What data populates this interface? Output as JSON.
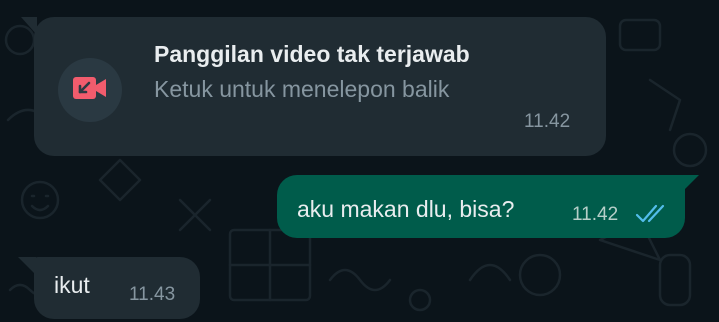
{
  "colors": {
    "background": "#0b141a",
    "incoming_bubble": "#202c33",
    "outgoing_bubble": "#005c4b",
    "missed_call_red": "#f15c6d",
    "read_tick_blue": "#53bdeb"
  },
  "messages": [
    {
      "type": "missed-call",
      "direction": "incoming",
      "title": "Panggilan video tak terjawab",
      "subtitle": "Ketuk untuk menelepon balik",
      "time": "11.42",
      "icon": "missed-video-call-icon"
    },
    {
      "type": "text",
      "direction": "outgoing",
      "text": "aku makan dlu, bisa?",
      "time": "11.42",
      "status": "read",
      "status_icon": "double-check-icon"
    },
    {
      "type": "text",
      "direction": "incoming",
      "text": "ikut",
      "time": "11.43"
    }
  ]
}
